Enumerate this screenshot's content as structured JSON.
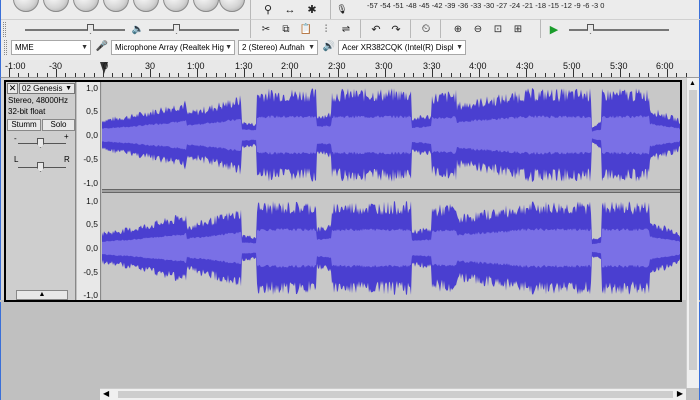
{
  "meter": {
    "record_scale": [
      "-57",
      "-54",
      "-51",
      "-48",
      "-45",
      "-42",
      "-39",
      "-36",
      "-33",
      "-30",
      "-27",
      "-24",
      "-21",
      "-18",
      "-15",
      "-12",
      "-9",
      "-6",
      "-3",
      "0"
    ]
  },
  "device_toolbar": {
    "host": "MME",
    "recording_device": "Microphone Array (Realtek Hig",
    "channels": "2 (Stereo) Aufnah",
    "playback_device": "Acer XR382CQK (Intel(R) Displ"
  },
  "ruler": {
    "labels": [
      "-1:00",
      "-30",
      "0",
      "30",
      "1:00",
      "1:30",
      "2:00",
      "2:30",
      "3:00",
      "3:30",
      "4:00",
      "4:30",
      "5:00",
      "5:30",
      "6:00"
    ]
  },
  "track": {
    "name": "02 Genesis",
    "rate_info": "Stereo, 48000Hz",
    "format": "32-bit float",
    "mute_label": "Stumm",
    "solo_label": "Solo",
    "gain_minus": "-",
    "gain_plus": "+",
    "pan_left": "L",
    "pan_right": "R",
    "scale_labels": [
      "1,0",
      "0,5",
      "0,0",
      "-0,5",
      "-1,0"
    ],
    "wave_color": "#4a3fd0"
  }
}
